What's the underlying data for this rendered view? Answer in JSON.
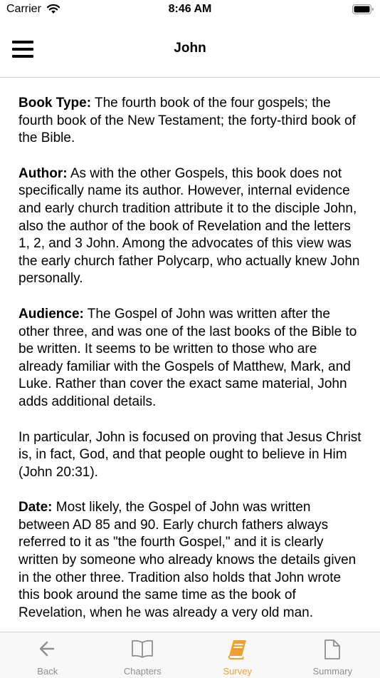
{
  "status_bar": {
    "carrier": "Carrier",
    "time": "8:46 AM"
  },
  "nav": {
    "title": "John"
  },
  "content": {
    "paragraphs": [
      {
        "label": "Book Type:",
        "text": " The fourth book of the four gospels; the fourth book of the New Testament; the forty-third book of the Bible."
      },
      {
        "label": "Author:",
        "text": " As with the other Gospels, this book does not specifically name its author. However, internal evidence and early church tradition attribute it to the disciple John, also the author of the book of Revelation and the letters 1, 2, and 3 John. Among the advocates of this view was the early church father Polycarp, who actually knew John personally."
      },
      {
        "label": "Audience:",
        "text": " The Gospel of John was written after the other three, and was one of the last books of the Bible to be written. It seems to be written to those who are already familiar with the Gospels of Matthew, Mark, and Luke. Rather than cover the exact same material, John adds additional details."
      },
      {
        "label": "",
        "text": "In particular, John is focused on proving that Jesus Christ is, in fact, God, and that people ought to believe in Him (John 20:31)."
      },
      {
        "label": "Date:",
        "text": " Most likely, the Gospel of John was written between AD 85 and 90. Early church fathers always referred to it as \"the fourth Gospel,\" and it is clearly written by someone who already knows the details given in the other three. Tradition also holds that John wrote this book around the same time as the book of Revelation, when he was already a very old man."
      }
    ]
  },
  "tabs": [
    {
      "label": "Back",
      "icon": "back-arrow-icon"
    },
    {
      "label": "Chapters",
      "icon": "book-open-icon"
    },
    {
      "label": "Survey",
      "icon": "book-stack-icon",
      "active": true
    },
    {
      "label": "Summary",
      "icon": "document-icon"
    }
  ],
  "colors": {
    "accent": "#f0a030",
    "inactive": "#8e8e93",
    "tab_bar_bg": "#f8f8f8"
  }
}
